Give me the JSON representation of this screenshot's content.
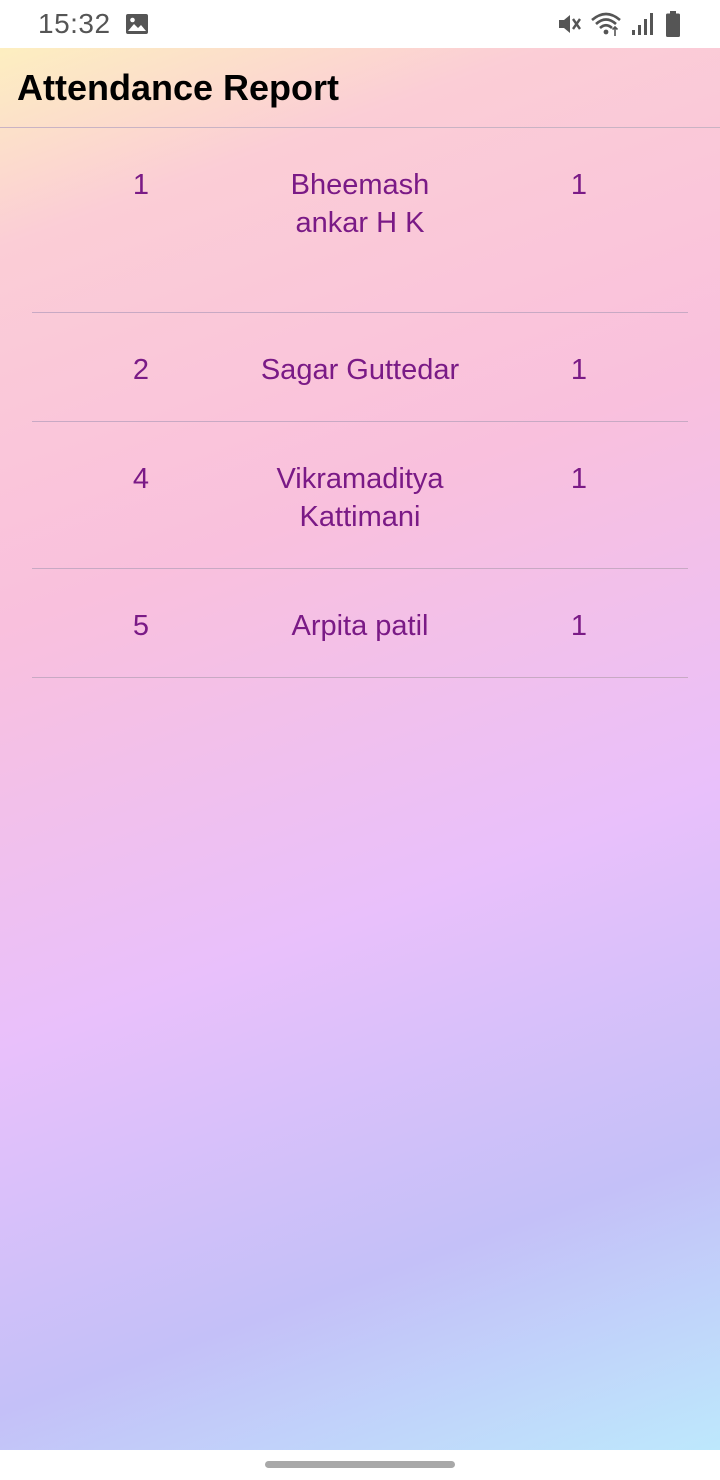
{
  "status_bar": {
    "time": "15:32",
    "icons": [
      "image-icon",
      "mute-icon",
      "wifi-icon",
      "signal-icon",
      "battery-icon"
    ]
  },
  "app_bar": {
    "title": "Attendance Report"
  },
  "report": {
    "rows": [
      {
        "id": "1",
        "name": "Bheemashankar H K",
        "count": "1"
      },
      {
        "id": "2",
        "name": "Sagar Guttedar",
        "count": "1"
      },
      {
        "id": "4",
        "name": "Vikramaditya Kattimani",
        "count": "1"
      },
      {
        "id": "5",
        "name": "Arpita patil",
        "count": "1"
      }
    ]
  },
  "colors": {
    "row_text": "#7a1a86",
    "title_text": "#000000",
    "divider": "#c8a9c4",
    "gradient_stops": [
      "#fdefc0",
      "#f9c0dd",
      "#e9c0fb",
      "#c4c0f8",
      "#bde8fc"
    ]
  }
}
